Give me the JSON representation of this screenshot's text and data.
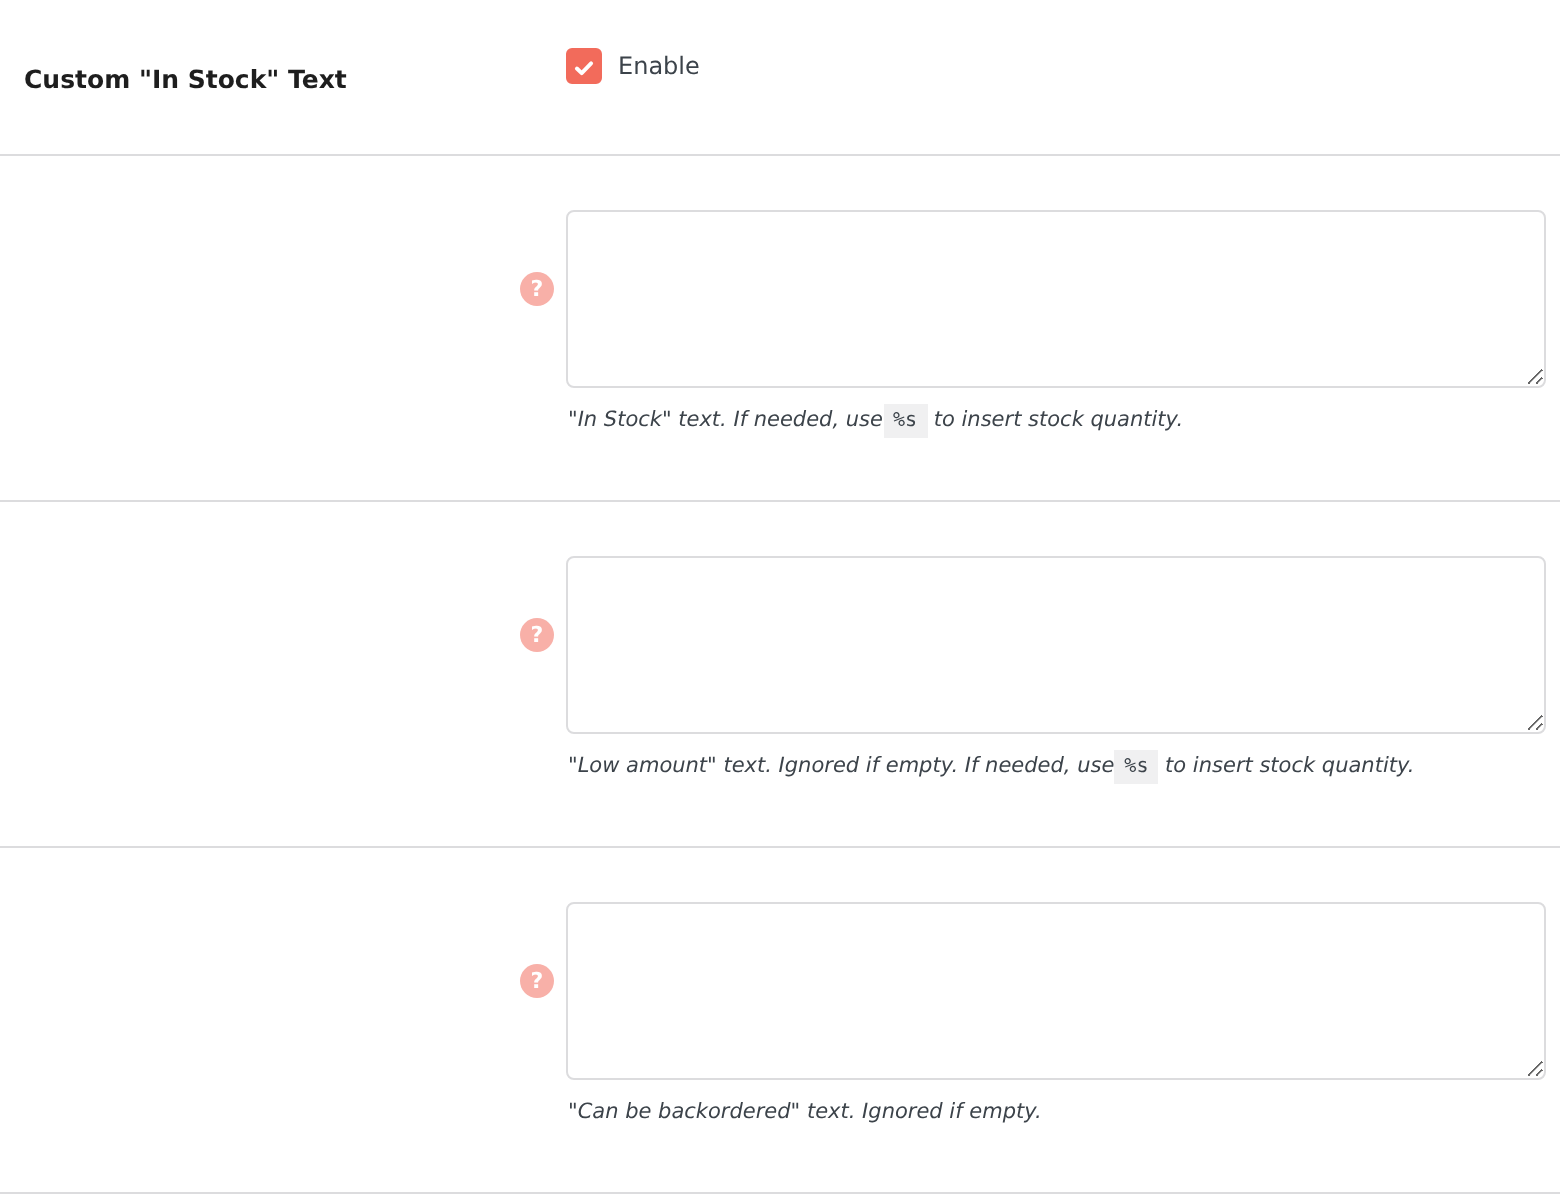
{
  "setting": {
    "label": "Custom \"In Stock\" Text",
    "checkbox": {
      "label": "Enable",
      "checked": true
    }
  },
  "fields": [
    {
      "help": "?",
      "description": {
        "before": "\"In Stock\" text. If needed, use",
        "code": "%s",
        "after": "to insert stock quantity."
      }
    },
    {
      "help": "?",
      "description": {
        "before": "\"Low amount\" text. Ignored if empty. If needed, use",
        "code": "%s",
        "after": "to insert stock quantity."
      }
    },
    {
      "help": "?",
      "description": {
        "before": "\"Can be backordered\" text. Ignored if empty."
      }
    }
  ]
}
